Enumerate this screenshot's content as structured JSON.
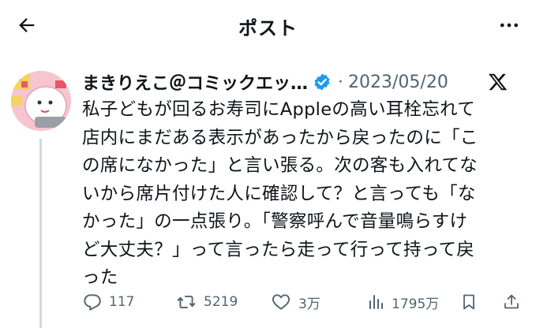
{
  "header": {
    "title": "ポスト",
    "back_icon": "arrow-left-icon",
    "more_icon": "more-dots-icon"
  },
  "tweet": {
    "user_name": "まきりえこ＠コミックエッ…",
    "date": "2023/05/20",
    "dot": "·",
    "verified_color": "#1d9bf0",
    "lines": [
      "私子どもが回るお寿司にAppleの高い耳栓忘れて",
      "店内にまだある表示があったから戻ったのに「こ",
      "の席になかった」と言い張る。次の客も入れてな",
      "いから席片付けた人に確認して？と言っても「な",
      "かった」の一点張り。「警察呼んで音量鳴らすけ",
      "ど大丈夫？」って言ったら走って行って持って戻",
      "った"
    ]
  },
  "actions": {
    "reply_count": "117",
    "retweet_count": "5219",
    "like_count": "3万",
    "view_count": "1795万"
  },
  "colors": {
    "text": "#0f1419",
    "secondary": "#536471",
    "accent": "#1d9bf0"
  }
}
